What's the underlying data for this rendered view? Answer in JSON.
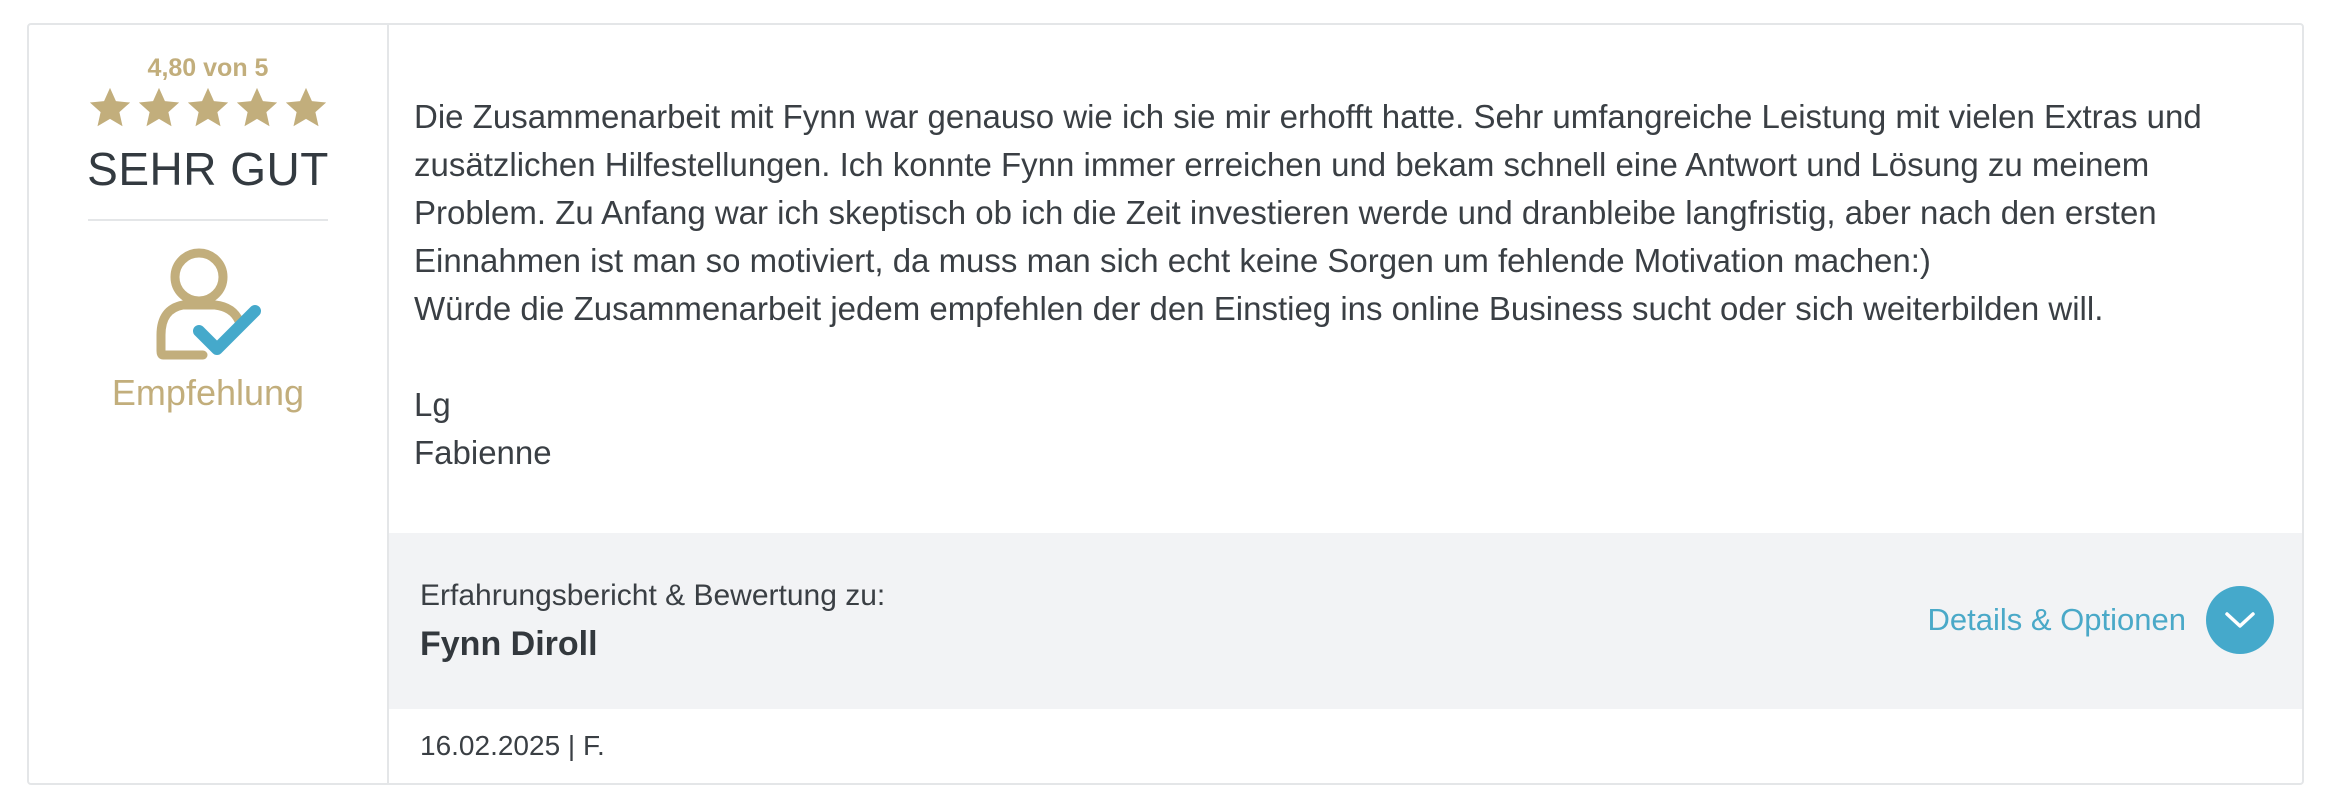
{
  "rating": {
    "score_text": "4,80 von 5",
    "score_value": 4.8,
    "score_max": 5,
    "stars_filled": 5,
    "verdict": "SEHR GUT"
  },
  "badge": {
    "icon": "user-check-icon",
    "label": "Empfehlung"
  },
  "review": {
    "text": "Die Zusammenarbeit mit Fynn war genauso wie ich sie mir erhofft hatte. Sehr umfangreiche Leistung mit vielen Extras und zusätzlichen Hilfestellungen. Ich konnte Fynn immer erreichen und bekam schnell eine Antwort und Lösung zu meinem Problem. Zu Anfang war ich skeptisch ob ich die Zeit investieren werde und dranbleibe langfristig, aber nach den ersten Einnahmen ist man so motiviert, da muss man sich echt keine Sorgen um fehlende Motivation machen:)\nWürde die Zusammenarbeit jedem empfehlen der den Einstieg ins online Business sucht oder sich weiterbilden will.\n\nLg\nFabienne"
  },
  "meta": {
    "caption": "Erfahrungsbericht & Bewertung zu:",
    "subject_name": "Fynn Diroll",
    "options_label": "Details & Optionen",
    "options_icon": "chevron-down-icon"
  },
  "footer": {
    "date_author": "16.02.2025 | F."
  },
  "colors": {
    "gold": "#c2ae7c",
    "accent_blue": "#45a9cb",
    "text_dark": "#3a3f44",
    "meta_background": "#f2f3f5",
    "border": "#e4e6e8"
  }
}
